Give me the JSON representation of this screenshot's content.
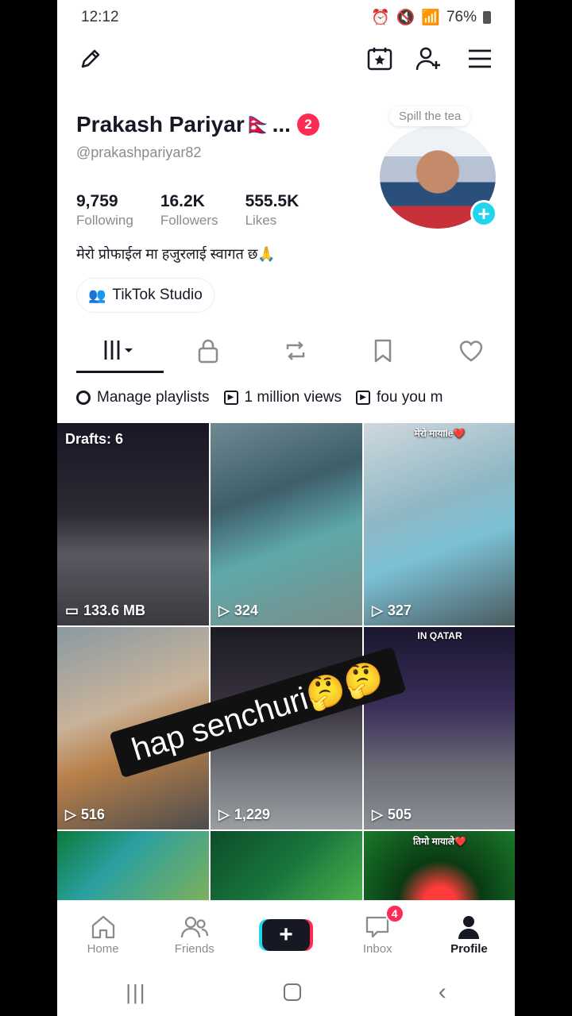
{
  "status": {
    "time": "12:12",
    "battery": "76%"
  },
  "profile": {
    "name": "Prakash Pariyar🇳🇵...",
    "notif_count": "2",
    "handle": "@prakashpariyar82",
    "stats": [
      {
        "value": "9,759",
        "label": "Following"
      },
      {
        "value": "16.2K",
        "label": "Followers"
      },
      {
        "value": "555.5K",
        "label": "Likes"
      }
    ],
    "bio": "मेरो प्रोफाईल मा हजुरलाई स्वागत छ🙏",
    "studio_label": "TikTok Studio",
    "spill_label": "Spill the tea"
  },
  "playlists": [
    "Manage playlists",
    "1 million views",
    "fou you m"
  ],
  "grid": [
    {
      "drafts": "Drafts: 6",
      "meta": "133.6 MB",
      "meta_icon": "drafts-icon",
      "caption": "",
      "bg": "linear-gradient(180deg,#1a1626 0%,#2d2a35 45%,#5b5860 65%,#3a3a40 100%)"
    },
    {
      "drafts": "",
      "meta": "324",
      "meta_icon": "play-icon",
      "caption": "",
      "bg": "linear-gradient(160deg,#6f8a93 0%,#3e5e6a 35%,#5fa9a9 60%,#7a8c8a 100%)"
    },
    {
      "drafts": "",
      "meta": "327",
      "meta_icon": "play-icon",
      "caption": "मेरो मायाle❤️",
      "bg": "linear-gradient(160deg,#cfd8dd 0%,#8fb7c4 40%,#7cc1d6 60%,#4a5a5e 100%)"
    },
    {
      "drafts": "",
      "meta": "516",
      "meta_icon": "play-icon",
      "caption": "",
      "bg": "linear-gradient(160deg,#8a9aa3 0%,#c9b39a 40%,#b8804a 60%,#4c4c4c 100%)"
    },
    {
      "drafts": "",
      "meta": "1,229",
      "meta_icon": "play-icon",
      "caption": "",
      "bg": "linear-gradient(180deg,#1b1a22 0%,#3a3440 40%,#6f7278 70%,#9a9ea3 100%)"
    },
    {
      "drafts": "",
      "meta": "505",
      "meta_icon": "play-icon",
      "caption": "IN QATAR",
      "bg": "linear-gradient(180deg,#1a1630 0%,#3b2f5a 40%,#6a6b74 70%,#8c8f95 100%)"
    },
    {
      "drafts": "",
      "meta": "",
      "meta_icon": "",
      "caption": "",
      "bg": "linear-gradient(135deg,#0c7a3a 0%,#2aa0a0 40%,#7fb05a 100%)"
    },
    {
      "drafts": "",
      "meta": "",
      "meta_icon": "",
      "caption": "",
      "bg": "linear-gradient(135deg,#0d4d2a 0%,#18753c 50%,#4cb04c 100%)"
    },
    {
      "drafts": "",
      "meta": "",
      "meta_icon": "",
      "caption": "तिमो मायाले❤️",
      "bg": "radial-gradient(circle at 50% 100%,#ff3b3b 0 15%,#0a3a14 40%,#1a7a2a 100%)"
    }
  ],
  "sticker_text": "hap senchuri🤔🤔",
  "nav": [
    {
      "label": "Home",
      "icon": "home-icon"
    },
    {
      "label": "Friends",
      "icon": "friends-icon"
    },
    {
      "label": "",
      "icon": "create-icon"
    },
    {
      "label": "Inbox",
      "icon": "inbox-icon",
      "badge": "4"
    },
    {
      "label": "Profile",
      "icon": "profile-icon"
    }
  ]
}
